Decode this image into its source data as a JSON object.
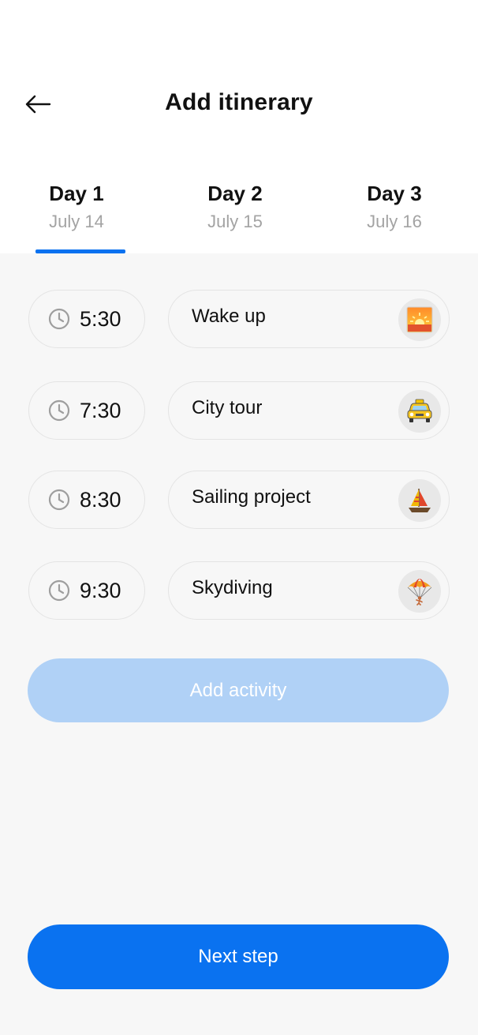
{
  "header": {
    "title": "Add itinerary",
    "back_icon": "arrow-left-icon"
  },
  "tabs": [
    {
      "day": "Day 1",
      "date": "July 14",
      "active": true
    },
    {
      "day": "Day 2",
      "date": "July 15",
      "active": false
    },
    {
      "day": "Day 3",
      "date": "July 16",
      "active": false
    }
  ],
  "activities": [
    {
      "time": "5:30",
      "label": "Wake up",
      "icon": "sunrise-icon"
    },
    {
      "time": "7:30",
      "label": "City tour",
      "icon": "taxi-icon"
    },
    {
      "time": "8:30",
      "label": "Sailing project",
      "icon": "sailboat-icon"
    },
    {
      "time": "9:30",
      "label": "Skydiving",
      "icon": "parachute-icon"
    }
  ],
  "buttons": {
    "add_activity": "Add activity",
    "next_step": "Next step"
  },
  "colors": {
    "accent": "#0a72f0",
    "accent_disabled": "#b0d1f6",
    "background": "#f7f7f7",
    "muted_text": "#a3a3a3"
  }
}
